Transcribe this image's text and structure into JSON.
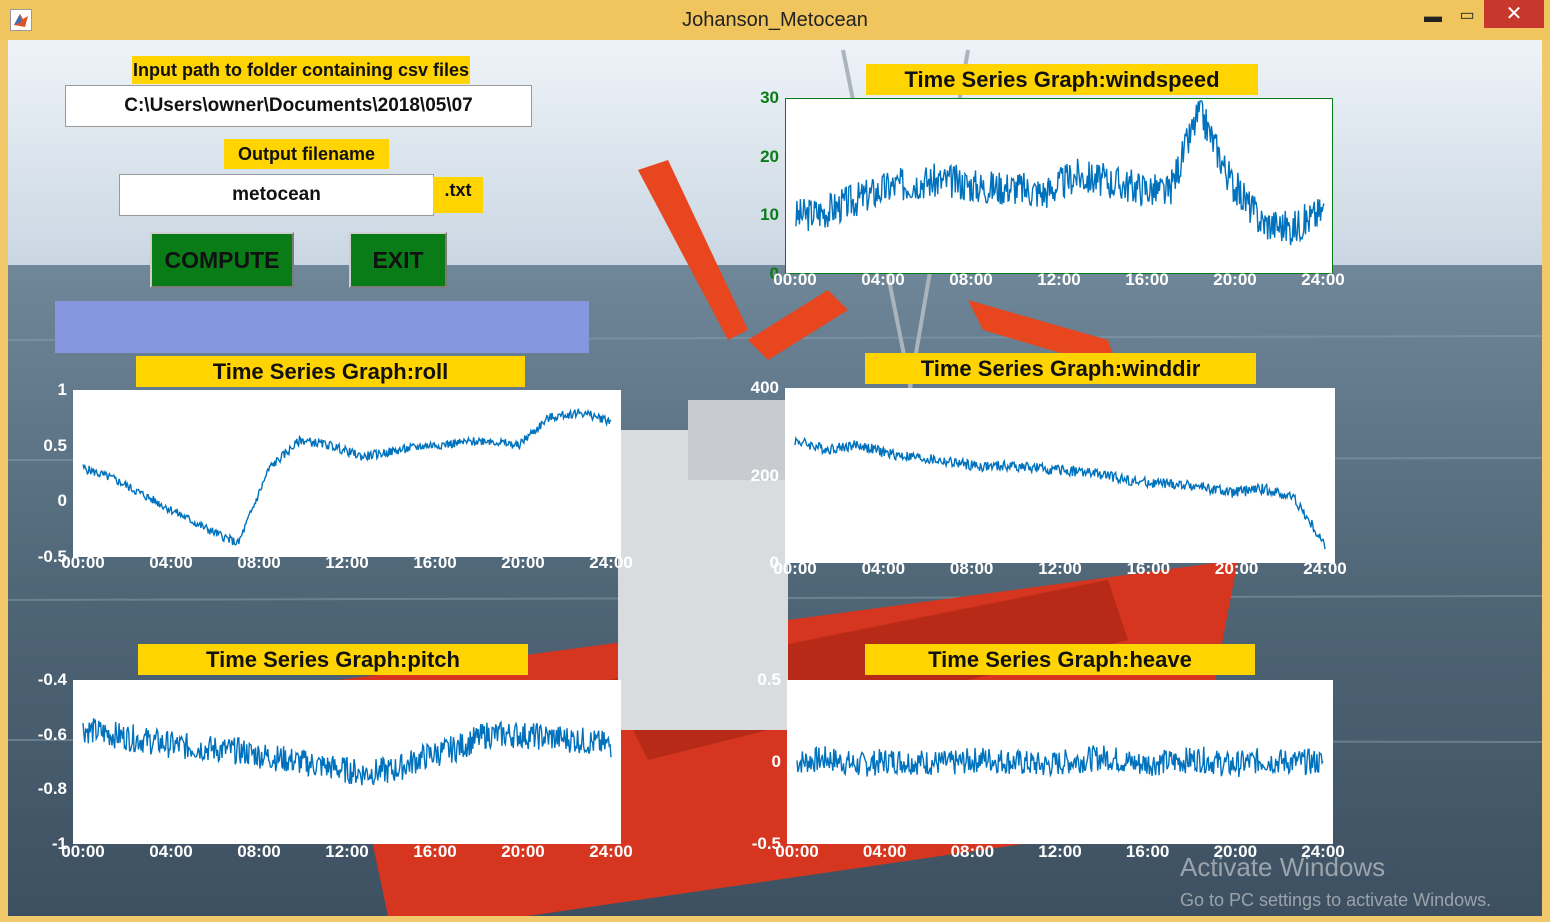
{
  "window": {
    "title": "Johanson_Metocean",
    "min_glyph": "▬",
    "max_glyph": "▭",
    "close_glyph": "✕"
  },
  "inputs": {
    "path_label": "Input path to folder containing csv files",
    "path_value": "C:\\Users\\owner\\Documents\\2018\\05\\07",
    "output_label": "Output filename",
    "output_value": "metocean",
    "extension": ".txt"
  },
  "buttons": {
    "compute": "COMPUTE",
    "exit": "EXIT"
  },
  "colors": {
    "label_bg": "#ffd400",
    "button_bg": "#0a7c17",
    "status_bar": "#8797df",
    "series": "#0072bd",
    "titlebar": "#f0c55e"
  },
  "chart_data": [
    {
      "type": "line",
      "title": "Time Series Graph:windspeed",
      "x": [
        "00:00",
        "04:00",
        "08:00",
        "12:00",
        "16:00",
        "20:00",
        "24:00"
      ],
      "ylim": [
        0,
        30
      ],
      "yticks": [
        "0",
        "10",
        "20",
        "30"
      ],
      "grid": false,
      "tick_color": "#0a7c17",
      "series": [
        {
          "values": [
            10,
            11,
            13,
            15,
            16,
            16,
            15,
            15,
            14,
            17,
            16,
            15,
            14,
            28,
            16,
            9,
            8,
            11
          ]
        }
      ]
    },
    {
      "type": "line",
      "title": "Time Series Graph:winddir",
      "x": [
        "00:00",
        "04:00",
        "08:00",
        "12:00",
        "16:00",
        "20:00",
        "24:00"
      ],
      "ylim": [
        0,
        400
      ],
      "yticks": [
        "0",
        "200",
        "400"
      ],
      "grid": false,
      "series": [
        {
          "values": [
            280,
            260,
            270,
            250,
            240,
            230,
            220,
            222,
            215,
            210,
            200,
            185,
            180,
            175,
            160,
            170,
            150,
            40
          ]
        }
      ]
    },
    {
      "type": "line",
      "title": "Time Series Graph:roll",
      "x": [
        "00:00",
        "04:00",
        "08:00",
        "12:00",
        "16:00",
        "20:00",
        "24:00"
      ],
      "ylim": [
        -0.5,
        1
      ],
      "yticks": [
        "-0.5",
        "0",
        "0.5",
        "1"
      ],
      "grid": false,
      "series": [
        {
          "values": [
            0.3,
            0.2,
            0.05,
            -0.1,
            -0.25,
            -0.38,
            0.3,
            0.55,
            0.5,
            0.4,
            0.45,
            0.5,
            0.52,
            0.55,
            0.5,
            0.75,
            0.8,
            0.72
          ]
        }
      ]
    },
    {
      "type": "line",
      "title": "Time Series Graph:pitch",
      "x": [
        "00:00",
        "04:00",
        "08:00",
        "12:00",
        "16:00",
        "20:00",
        "24:00"
      ],
      "ylim": [
        -1,
        -0.4
      ],
      "yticks": [
        "-1",
        "-0.8",
        "-0.6",
        "-0.4"
      ],
      "grid": false,
      "series": [
        {
          "values": [
            -0.58,
            -0.6,
            -0.62,
            -0.64,
            -0.65,
            -0.66,
            -0.68,
            -0.7,
            -0.72,
            -0.74,
            -0.73,
            -0.68,
            -0.65,
            -0.6,
            -0.6,
            -0.61,
            -0.62,
            -0.64
          ]
        }
      ]
    },
    {
      "type": "line",
      "title": "Time Series Graph:heave",
      "x": [
        "00:00",
        "04:00",
        "08:00",
        "12:00",
        "16:00",
        "20:00",
        "24:00"
      ],
      "ylim": [
        -0.5,
        0.5
      ],
      "yticks": [
        "-0.5",
        "0",
        "0.5"
      ],
      "grid": false,
      "series": [
        {
          "values": [
            0,
            0.02,
            -0.02,
            0.01,
            0,
            -0.01,
            0.02,
            0,
            -0.02,
            0.01,
            0.03,
            -0.01,
            0,
            0.02,
            -0.02,
            0.01,
            0,
            0
          ]
        }
      ]
    }
  ],
  "watermark": {
    "line1": "Activate Windows",
    "line2": "Go to PC settings to activate Windows."
  }
}
